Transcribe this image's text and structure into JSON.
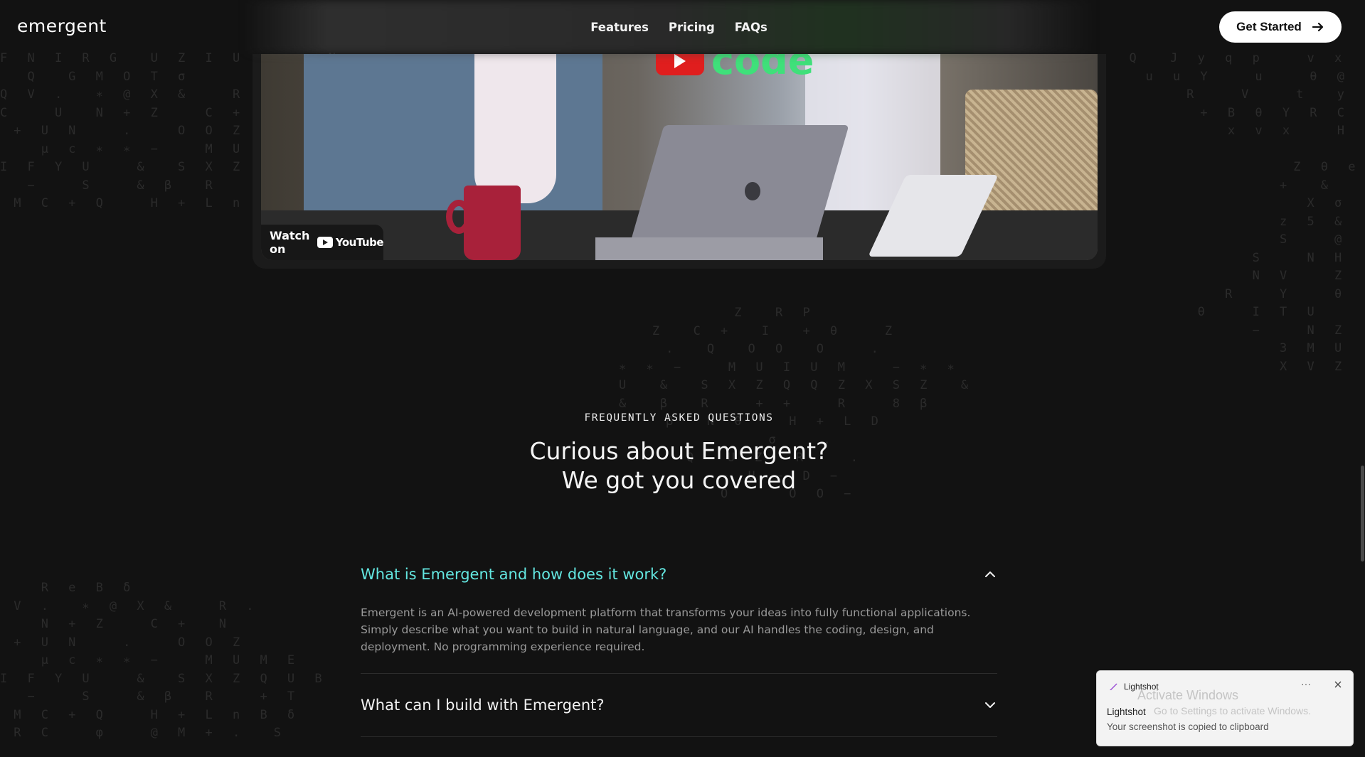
{
  "nav": {
    "logo": "emergent",
    "links": [
      "Features",
      "Pricing",
      "FAQs"
    ],
    "cta_label": "Get Started"
  },
  "video": {
    "overlay_logo_text": "code",
    "watch_on_label": "Watch on",
    "youtube_label": "YouTube"
  },
  "faq": {
    "eyebrow": "FREQUENTLY ASKED QUESTIONS",
    "title_line1": "Curious about Emergent?",
    "title_line2": "We got you covered",
    "items": [
      {
        "question": "What is Emergent and how does it work?",
        "answer": "Emergent is an AI-powered development platform that transforms your ideas into fully functional applications. Simply describe what you want to build in natural language, and our AI handles the coding, design, and deployment. No programming experience required.",
        "expanded": true
      },
      {
        "question": "What can I build with Emergent?",
        "expanded": false
      }
    ]
  },
  "toast": {
    "app_name": "Lightshot",
    "watermark_title": "Activate Windows",
    "watermark_sub": "Go to Settings to activate Windows.",
    "title": "Lightshot",
    "message": "Your screenshot is copied to clipboard",
    "more_label": "···"
  },
  "colors": {
    "background": "#121212",
    "accent": "#63e6e0",
    "cta_bg": "#ffffff"
  }
}
